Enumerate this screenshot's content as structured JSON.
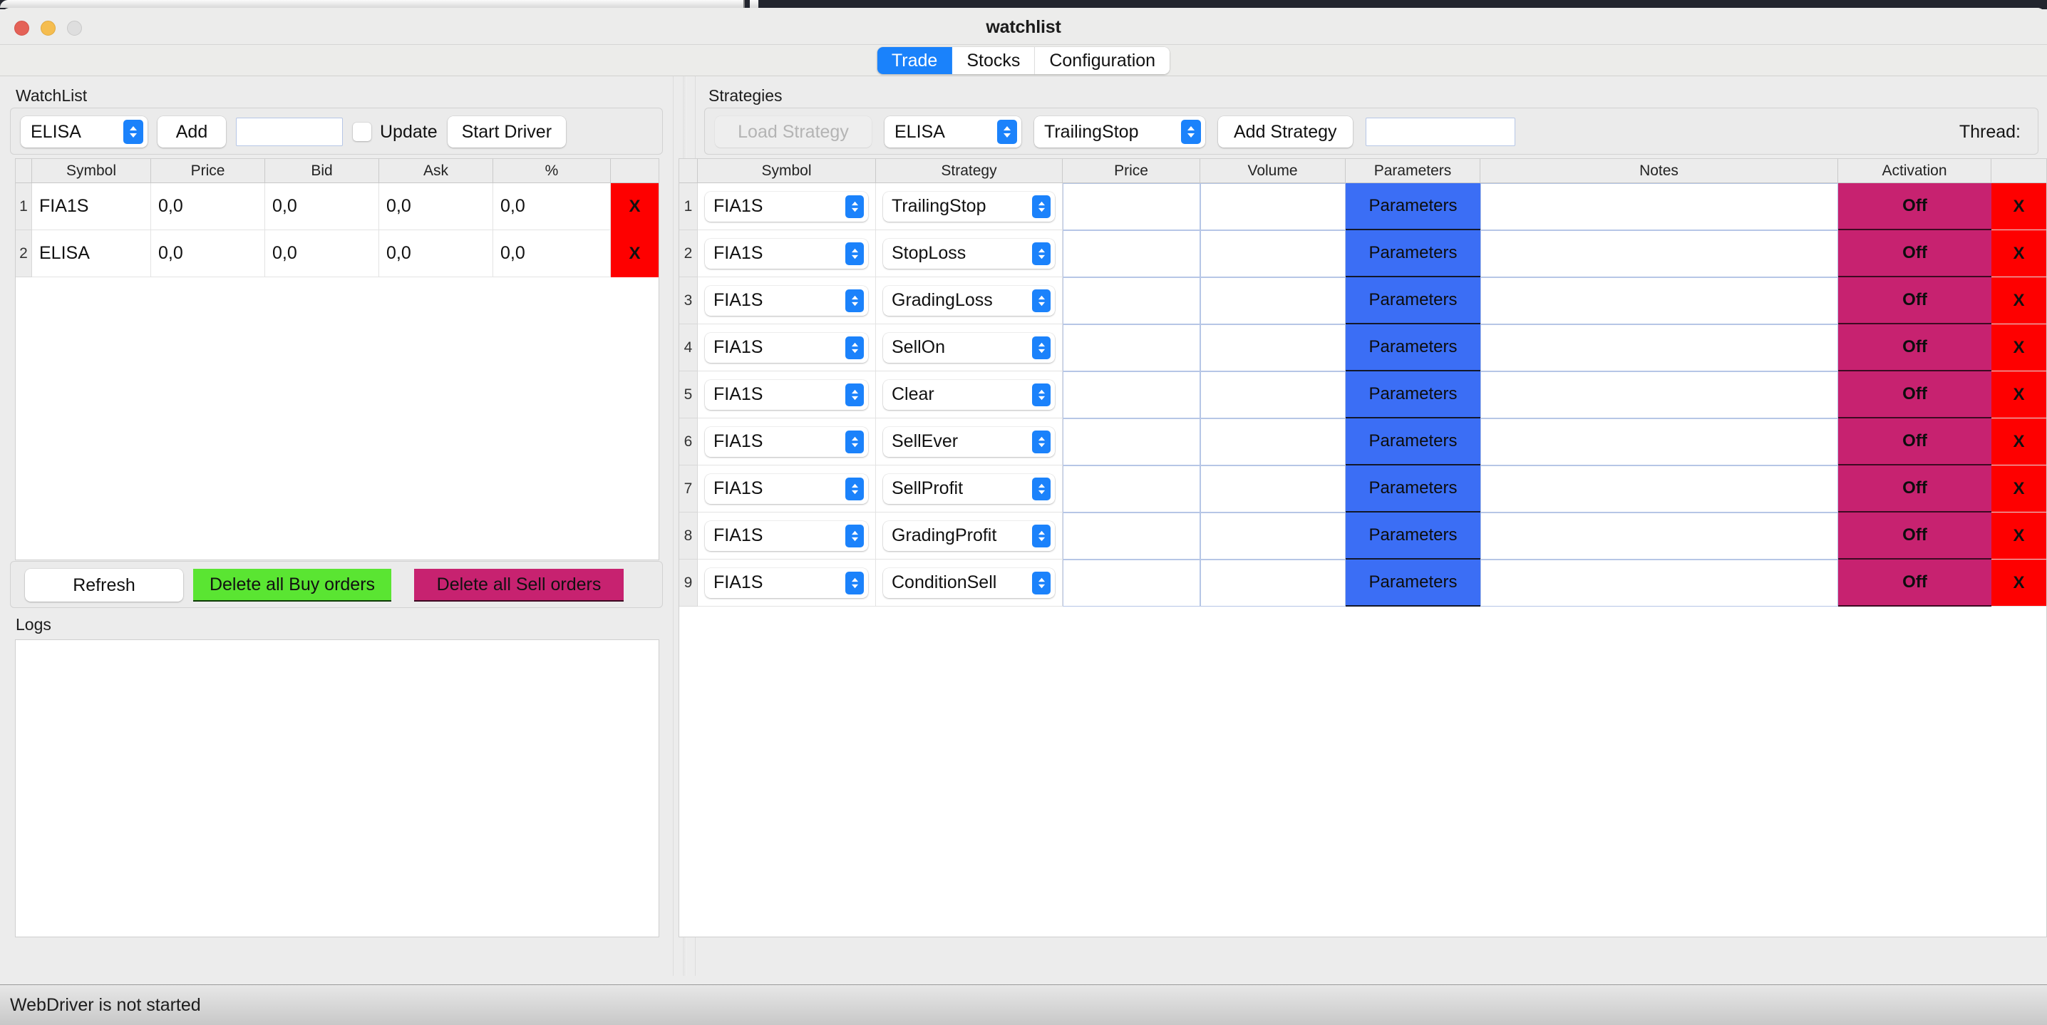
{
  "window": {
    "title": "watchlist",
    "traffic_lights": [
      "close",
      "minimize",
      "zoom"
    ]
  },
  "tabs": [
    {
      "label": "Trade",
      "active": true
    },
    {
      "label": "Stocks",
      "active": false
    },
    {
      "label": "Configuration",
      "active": false
    }
  ],
  "watchlist": {
    "group_label": "WatchList",
    "symbol_select": {
      "value": "ELISA"
    },
    "add_button": "Add",
    "add_input": {
      "value": "",
      "placeholder": ""
    },
    "update_checkbox": {
      "label": "Update",
      "checked": false
    },
    "start_driver_button": "Start Driver",
    "columns": [
      "Symbol",
      "Price",
      "Bid",
      "Ask",
      "%",
      ""
    ],
    "rows": [
      {
        "num": "1",
        "symbol": "FIA1S",
        "price": "0,0",
        "bid": "0,0",
        "ask": "0,0",
        "pct": "0,0",
        "delete": "X"
      },
      {
        "num": "2",
        "symbol": "ELISA",
        "price": "0,0",
        "bid": "0,0",
        "ask": "0,0",
        "pct": "0,0",
        "delete": "X"
      }
    ],
    "actions": {
      "refresh": "Refresh",
      "delete_buy": "Delete all Buy orders",
      "delete_sell": "Delete all Sell orders"
    }
  },
  "logs": {
    "group_label": "Logs",
    "content": ""
  },
  "strategies": {
    "group_label": "Strategies",
    "load_strategy_button": {
      "label": "Load Strategy",
      "disabled": true
    },
    "symbol_select": {
      "value": "ELISA"
    },
    "strategy_select": {
      "value": "TrailingStop"
    },
    "add_strategy_button": "Add Strategy",
    "add_strategy_input": {
      "value": "",
      "placeholder": ""
    },
    "thread_label": "Thread:",
    "columns": [
      "Symbol",
      "Strategy",
      "Price",
      "Volume",
      "Parameters",
      "Notes",
      "Activation",
      ""
    ],
    "rows": [
      {
        "num": "1",
        "symbol": "FIA1S",
        "strategy": "TrailingStop",
        "price": "",
        "volume": "",
        "parameters": "Parameters",
        "notes": "",
        "activation": "Off",
        "delete": "X"
      },
      {
        "num": "2",
        "symbol": "FIA1S",
        "strategy": "StopLoss",
        "price": "",
        "volume": "",
        "parameters": "Parameters",
        "notes": "",
        "activation": "Off",
        "delete": "X"
      },
      {
        "num": "3",
        "symbol": "FIA1S",
        "strategy": "GradingLoss",
        "price": "",
        "volume": "",
        "parameters": "Parameters",
        "notes": "",
        "activation": "Off",
        "delete": "X"
      },
      {
        "num": "4",
        "symbol": "FIA1S",
        "strategy": "SellOn",
        "price": "",
        "volume": "",
        "parameters": "Parameters",
        "notes": "",
        "activation": "Off",
        "delete": "X"
      },
      {
        "num": "5",
        "symbol": "FIA1S",
        "strategy": "Clear",
        "price": "",
        "volume": "",
        "parameters": "Parameters",
        "notes": "",
        "activation": "Off",
        "delete": "X"
      },
      {
        "num": "6",
        "symbol": "FIA1S",
        "strategy": "SellEver",
        "price": "",
        "volume": "",
        "parameters": "Parameters",
        "notes": "",
        "activation": "Off",
        "delete": "X"
      },
      {
        "num": "7",
        "symbol": "FIA1S",
        "strategy": "SellProfit",
        "price": "",
        "volume": "",
        "parameters": "Parameters",
        "notes": "",
        "activation": "Off",
        "delete": "X"
      },
      {
        "num": "8",
        "symbol": "FIA1S",
        "strategy": "GradingProfit",
        "price": "",
        "volume": "",
        "parameters": "Parameters",
        "notes": "",
        "activation": "Off",
        "delete": "X"
      },
      {
        "num": "9",
        "symbol": "FIA1S",
        "strategy": "ConditionSell",
        "price": "",
        "volume": "",
        "parameters": "Parameters",
        "notes": "",
        "activation": "Off",
        "delete": "X"
      }
    ]
  },
  "statusbar": {
    "text": "WebDriver is not started"
  },
  "colors": {
    "accent_blue": "#1a82fb",
    "parameters_blue": "#3b6ef5",
    "activation_pink": "#c72270",
    "delete_red": "#fe0000",
    "buy_green": "#5ae532",
    "window_bg": "#ececec"
  }
}
